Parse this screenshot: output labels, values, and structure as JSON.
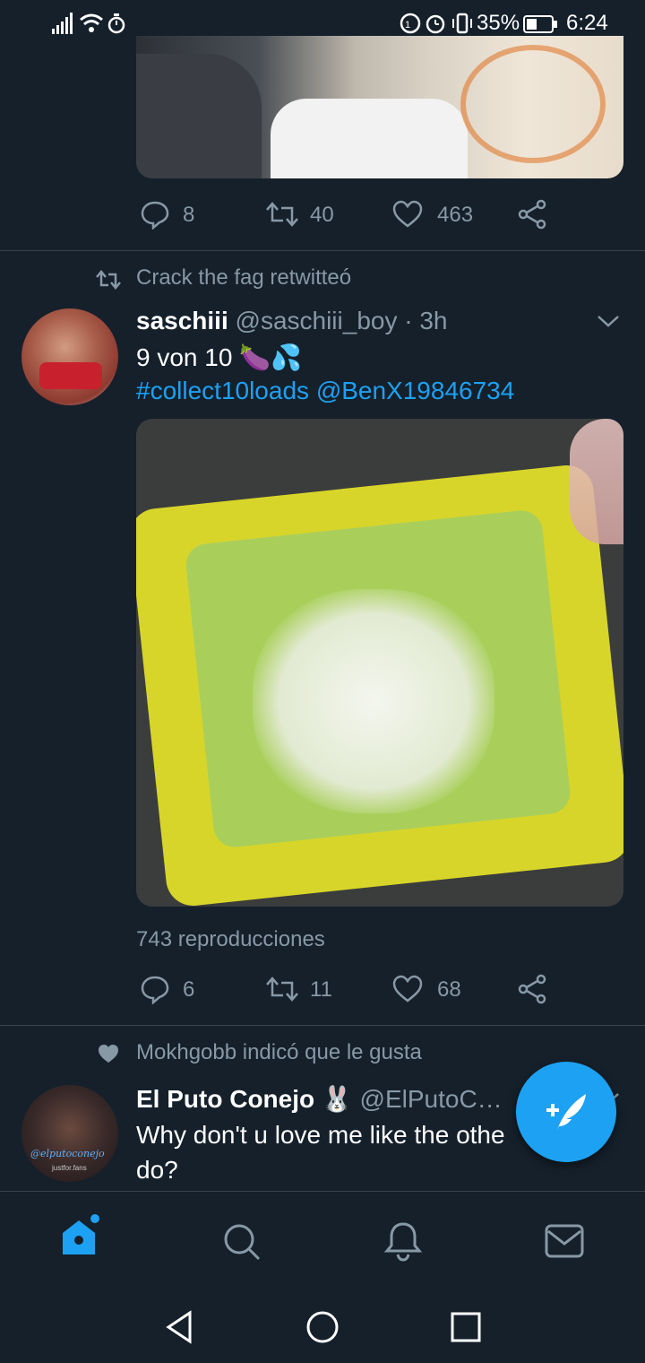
{
  "status_bar": {
    "battery": "35%",
    "time": "6:24"
  },
  "tweet1": {
    "reply_count": "8",
    "retweet_count": "40",
    "like_count": "463"
  },
  "tweet2": {
    "context": "Crack the fag retwitteó",
    "name": "saschiii",
    "handle": "@saschiii_boy",
    "dot": "·",
    "time": "3h",
    "text_line1": "9 von 10 🍆💦",
    "hashtag": "#collect10loads",
    "mention": "@BenX19846734",
    "views": "743 reproducciones",
    "reply_count": "6",
    "retweet_count": "11",
    "like_count": "68"
  },
  "tweet3": {
    "context": "Mokhgobb indicó que le gusta",
    "name": "El Puto Conejo 🐰",
    "handle": "@ElPutoC…",
    "text_line1": "Why don't u love me like the othe",
    "text_line2": "do?",
    "avatar_watermark": "@elputoconejo",
    "avatar_watermark2": "justfor.fans"
  },
  "fab": {
    "icon": "compose-tweet-icon"
  },
  "bottom_nav": {
    "icons": [
      "home-icon",
      "search-icon",
      "notifications-icon",
      "messages-icon"
    ],
    "active": "home-icon"
  },
  "colors": {
    "background": "#15202b",
    "accent": "#1da1f2",
    "secondary_text": "#8899a6",
    "divider": "#38444d"
  }
}
